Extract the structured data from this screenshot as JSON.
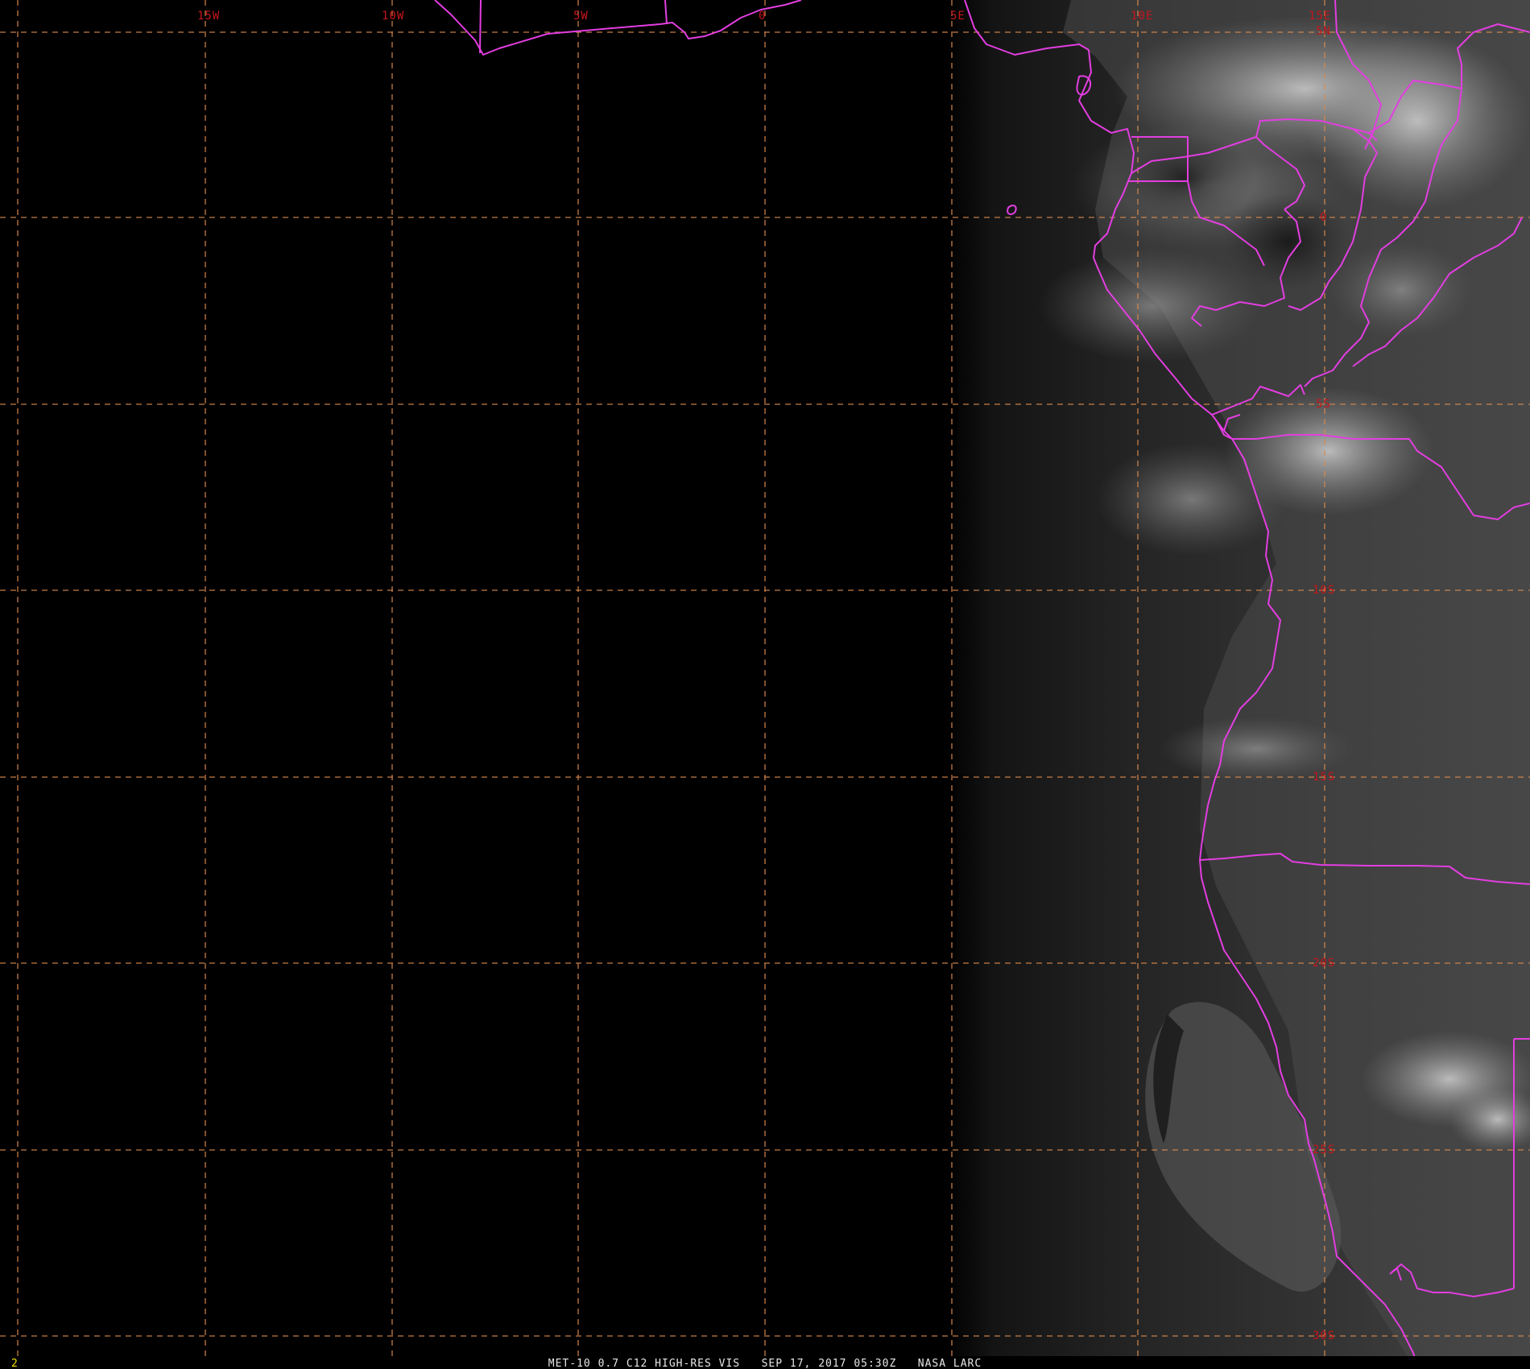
{
  "map": {
    "longitude_labels": [
      "15W",
      "10W",
      "5W",
      "0",
      "5E",
      "10E",
      "15E"
    ],
    "latitude_labels": [
      "5N",
      "0",
      "5S",
      "10S",
      "15S",
      "20S",
      "25S",
      "30S"
    ],
    "caption": "MET-10 0.7 C12 HIGH-RES VIS   SEP 17, 2017 05:30Z   NASA LARC",
    "frame_number": "2",
    "colors": {
      "background": "#000000",
      "graticule": "#d98a4e",
      "label": "#c4161c",
      "coastline": "#e23ee0",
      "caption": "#e6e6e6",
      "frame_number": "#f2e000"
    }
  }
}
